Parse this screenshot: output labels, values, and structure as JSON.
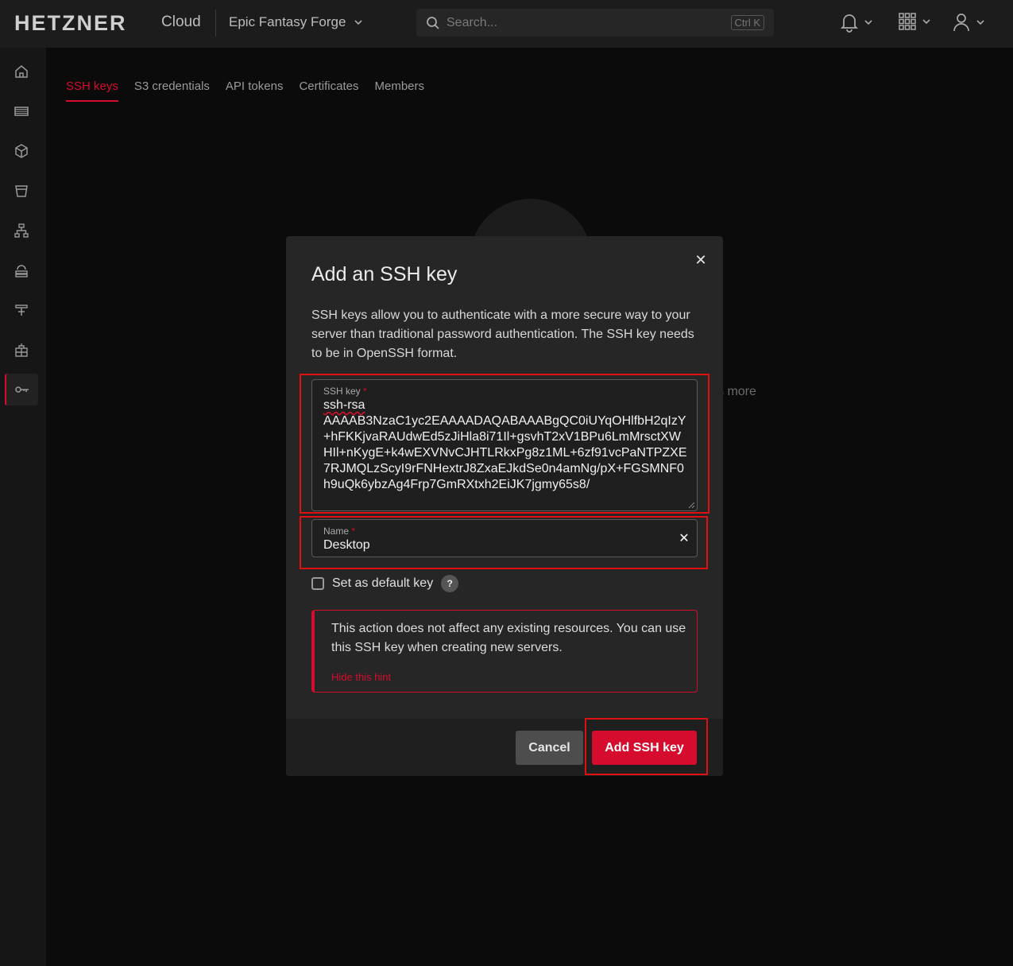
{
  "header": {
    "logo": "HETZNER",
    "logo_sub": "Cloud",
    "project": "Epic Fantasy Forge",
    "search_placeholder": "Search...",
    "search_shortcut": "Ctrl K"
  },
  "sidebar": {
    "items": [
      {
        "icon": "home-icon"
      },
      {
        "icon": "servers-icon"
      },
      {
        "icon": "volumes-icon"
      },
      {
        "icon": "buckets-icon"
      },
      {
        "icon": "networks-icon"
      },
      {
        "icon": "load-balancers-icon"
      },
      {
        "icon": "firewalls-icon"
      },
      {
        "icon": "floating-ips-icon"
      },
      {
        "icon": "security-key-icon",
        "active": true
      }
    ]
  },
  "tabs": [
    {
      "label": "SSH keys",
      "active": true
    },
    {
      "label": "S3 credentials"
    },
    {
      "label": "API tokens"
    },
    {
      "label": "Certificates"
    },
    {
      "label": "Members"
    }
  ],
  "background": {
    "text_fragment": "s more"
  },
  "modal": {
    "title": "Add an SSH key",
    "description": "SSH keys allow you to authenticate with a more secure way to your server than traditional password authentication. The SSH key needs to be in OpenSSH format.",
    "ssh_key_label": "SSH key",
    "ssh_key_required_mark": "*",
    "ssh_key_first": "ssh-rsa",
    "ssh_key_rest": "AAAAB3NzaC1yc2EAAAADAQABAAABgQC0iUYqOHlfbH2qIzY+hFKKjvaRAUdwEd5zJiHla8i71Il+gsvhT2xV1BPu6LmMrsctXWHIl+nKygE+k4wEXVNvCJHTLRkxPg8z1ML+6zf91vcPaNTPZXE7RJMQLzScyI9rFNHextrJ8ZxaEJkdSe0n4amNg/pX+FGSMNF0h9uQk6ybzAg4Frp7GmRXtxh2EiJK7jgmy65s8/",
    "name_label": "Name",
    "name_required_mark": "*",
    "name_value": "Desktop",
    "default_key_label": "Set as default key",
    "default_key_checked": false,
    "help_glyph": "?",
    "hint_text": "This action does not affect any existing resources. You can use this SSH key when creating new servers.",
    "hint_link": "Hide this hint",
    "cancel_label": "Cancel",
    "add_label": "Add SSH key",
    "close_glyph": "✕"
  },
  "colors": {
    "accent": "#d50c2d",
    "highlight": "#e01010"
  }
}
